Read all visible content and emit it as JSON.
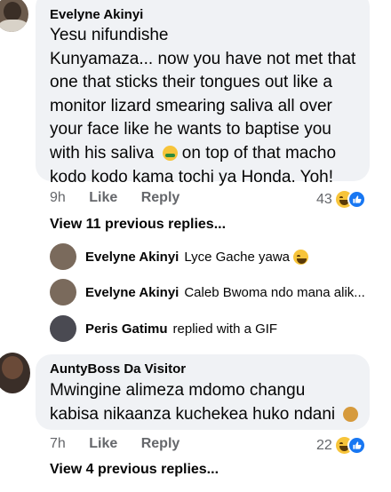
{
  "comments": [
    {
      "author": "Evelyne Akinyi",
      "lines": [
        "Yesu nifundishe",
        "Kunyamaza... now you have not met that",
        "one that sticks their tongues out like a",
        "monitor lizard smearing saliva all over",
        "your face like he wants to baptise you",
        "with his saliva",
        "on top of that macho",
        "kodo kodo kama tochi ya Honda. Yoh!"
      ],
      "time": "9h",
      "like_label": "Like",
      "reply_label": "Reply",
      "reaction_count": "43",
      "view_previous": "View 11 previous replies..."
    },
    {
      "author": "AuntyBoss Da Visitor",
      "lines": [
        "Mwingine alimeza mdomo changu",
        "kabisa nikaanza kuchekea huko ndani"
      ],
      "time": "7h",
      "like_label": "Like",
      "reply_label": "Reply",
      "reaction_count": "22",
      "view_previous": "View 4 previous replies..."
    }
  ],
  "replies": [
    {
      "name": "Evelyne Akinyi",
      "text": "Lyce Gache  yawa"
    },
    {
      "name": "Evelyne Akinyi",
      "text": "Caleb Bwoma ndo mana alik..."
    },
    {
      "name": "Peris Gatimu",
      "text": "replied with a GIF"
    }
  ],
  "icons": {
    "reaction": [
      "haha-reaction-icon",
      "like-reaction-icon"
    ],
    "inline": [
      "nauseated-face-emoji",
      "laughing-emoji",
      "woman-facepalming-emoji"
    ]
  }
}
